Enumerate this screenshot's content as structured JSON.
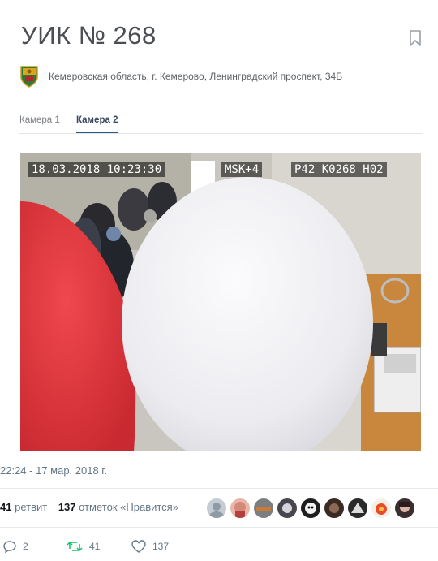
{
  "page": {
    "title": "УИК № 268",
    "address": "Кемеровская область, г. Кемерово, Ленинградский проспект, 34Б",
    "tabs": [
      {
        "label": "Камера 1",
        "active": false
      },
      {
        "label": "Камера 2",
        "active": true
      }
    ]
  },
  "camera_overlay": {
    "timestamp": "18.03.2018 10:23:30",
    "timezone": "MSK+4",
    "ids": "P42 K0268 H02"
  },
  "tweet": {
    "datetime": "22:24 - 17 мар. 2018 г.",
    "retweets_count": "41",
    "retweets_label": "ретвит",
    "likes_count": "137",
    "likes_label": "отметок «Нравится»",
    "actions": {
      "reply_count": "2",
      "retweet_count": "41",
      "like_count": "137"
    }
  },
  "colors": {
    "accent": "#2a5885",
    "retweet_green": "#17bf63",
    "text_muted": "#657786",
    "balloon_red": "#e0383d",
    "balloon_white": "#f4f4f6"
  }
}
